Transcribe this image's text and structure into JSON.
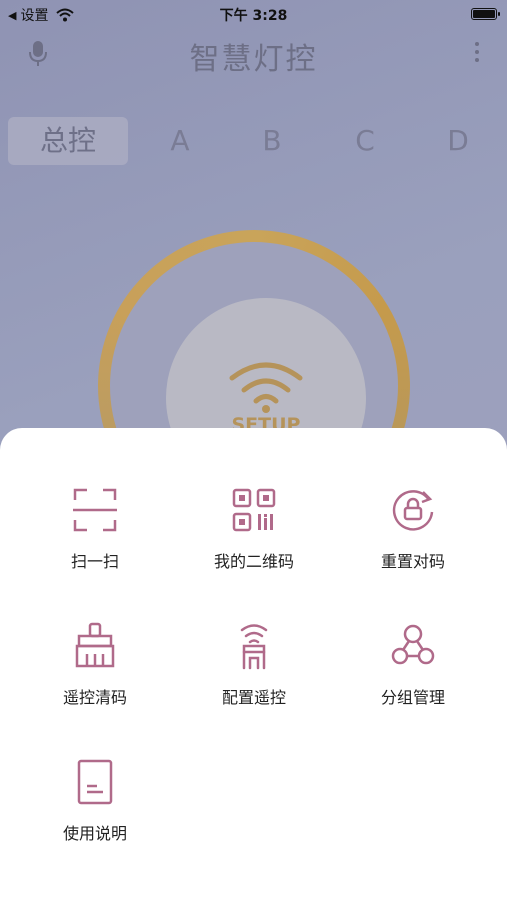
{
  "status_bar": {
    "back_label": "设置",
    "time": "下午 3:28"
  },
  "nav": {
    "title": "智慧灯控"
  },
  "tabs": [
    {
      "label": "总控",
      "active": true
    },
    {
      "label": "A"
    },
    {
      "label": "B"
    },
    {
      "label": "C"
    },
    {
      "label": "D"
    }
  ],
  "dial": {
    "center_label": "SETUP"
  },
  "menu": {
    "items": [
      {
        "label": "扫一扫",
        "icon": "scan-icon"
      },
      {
        "label": "我的二维码",
        "icon": "qr-code-icon"
      },
      {
        "label": "重置对码",
        "icon": "reset-pair-icon"
      },
      {
        "label": "遥控清码",
        "icon": "broom-icon"
      },
      {
        "label": "配置遥控",
        "icon": "remote-config-icon"
      },
      {
        "label": "分组管理",
        "icon": "group-icon"
      },
      {
        "label": "使用说明",
        "icon": "document-icon"
      }
    ]
  },
  "colors": {
    "accent": "#b06a8a",
    "dial_ring": "#c9a45a"
  }
}
